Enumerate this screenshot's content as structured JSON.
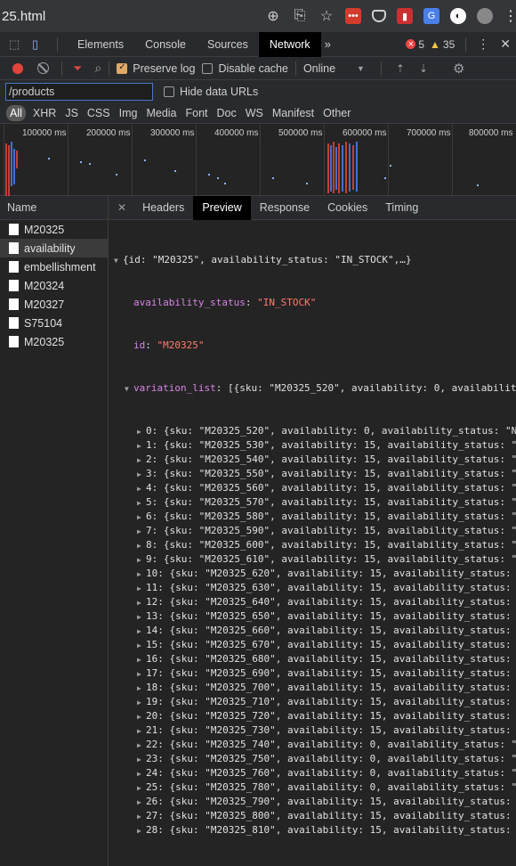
{
  "address_bar": {
    "url": "25.html"
  },
  "devtools": {
    "tabs": [
      "Elements",
      "Console",
      "Sources",
      "Network"
    ],
    "active_tab": "Network",
    "error_count": "5",
    "warning_count": "35"
  },
  "network_toolbar": {
    "preserve_log": "Preserve log",
    "disable_cache": "Disable cache",
    "throttling": "Online"
  },
  "filter": {
    "value": "/products",
    "hide_data_urls": "Hide data URLs",
    "types": [
      "All",
      "XHR",
      "JS",
      "CSS",
      "Img",
      "Media",
      "Font",
      "Doc",
      "WS",
      "Manifest",
      "Other"
    ]
  },
  "overview": {
    "ticks": [
      "100000 ms",
      "200000 ms",
      "300000 ms",
      "400000 ms",
      "500000 ms",
      "600000 ms",
      "700000 ms",
      "800000 ms"
    ]
  },
  "requests": {
    "header": "Name",
    "items": [
      "M20325",
      "availability",
      "embellishment",
      "M20324",
      "M20327",
      "S75104",
      "M20325"
    ]
  },
  "detail": {
    "tabs": [
      "Headers",
      "Preview",
      "Response",
      "Cookies",
      "Timing"
    ],
    "root_summary": "{id: \"M20325\", availability_status: \"IN_STOCK\",…}",
    "availability_status_key": "availability_status",
    "availability_status_value": "\"IN_STOCK\"",
    "id_key": "id",
    "id_value": "\"M20325\"",
    "variation_key": "variation_list",
    "variation_summary": "[{sku: \"M20325_520\", availability: 0, availabilit",
    "variations": [
      "0: {sku: \"M20325_520\", availability: 0, availability_status: \"N",
      "1: {sku: \"M20325_530\", availability: 15, availability_status: \"",
      "2: {sku: \"M20325_540\", availability: 15, availability_status: \"",
      "3: {sku: \"M20325_550\", availability: 15, availability_status: \"",
      "4: {sku: \"M20325_560\", availability: 15, availability_status: \"",
      "5: {sku: \"M20325_570\", availability: 15, availability_status: \"",
      "6: {sku: \"M20325_580\", availability: 15, availability_status: \"",
      "7: {sku: \"M20325_590\", availability: 15, availability_status: \"",
      "8: {sku: \"M20325_600\", availability: 15, availability_status: \"",
      "9: {sku: \"M20325_610\", availability: 15, availability_status: \"",
      "10: {sku: \"M20325_620\", availability: 15, availability_status:",
      "11: {sku: \"M20325_630\", availability: 15, availability_status:",
      "12: {sku: \"M20325_640\", availability: 15, availability_status:",
      "13: {sku: \"M20325_650\", availability: 15, availability_status:",
      "14: {sku: \"M20325_660\", availability: 15, availability_status:",
      "15: {sku: \"M20325_670\", availability: 15, availability_status:",
      "16: {sku: \"M20325_680\", availability: 15, availability_status:",
      "17: {sku: \"M20325_690\", availability: 15, availability_status:",
      "18: {sku: \"M20325_700\", availability: 15, availability_status:",
      "19: {sku: \"M20325_710\", availability: 15, availability_status:",
      "20: {sku: \"M20325_720\", availability: 15, availability_status:",
      "21: {sku: \"M20325_730\", availability: 15, availability_status:",
      "22: {sku: \"M20325_740\", availability: 0, availability_status: \"",
      "23: {sku: \"M20325_750\", availability: 0, availability_status: \"",
      "24: {sku: \"M20325_760\", availability: 0, availability_status: \"",
      "25: {sku: \"M20325_780\", availability: 0, availability_status: \"",
      "26: {sku: \"M20325_790\", availability: 15, availability_status:",
      "27: {sku: \"M20325_800\", availability: 15, availability_status:",
      "28: {sku: \"M20325_810\", availability: 15, availability_status:"
    ]
  }
}
